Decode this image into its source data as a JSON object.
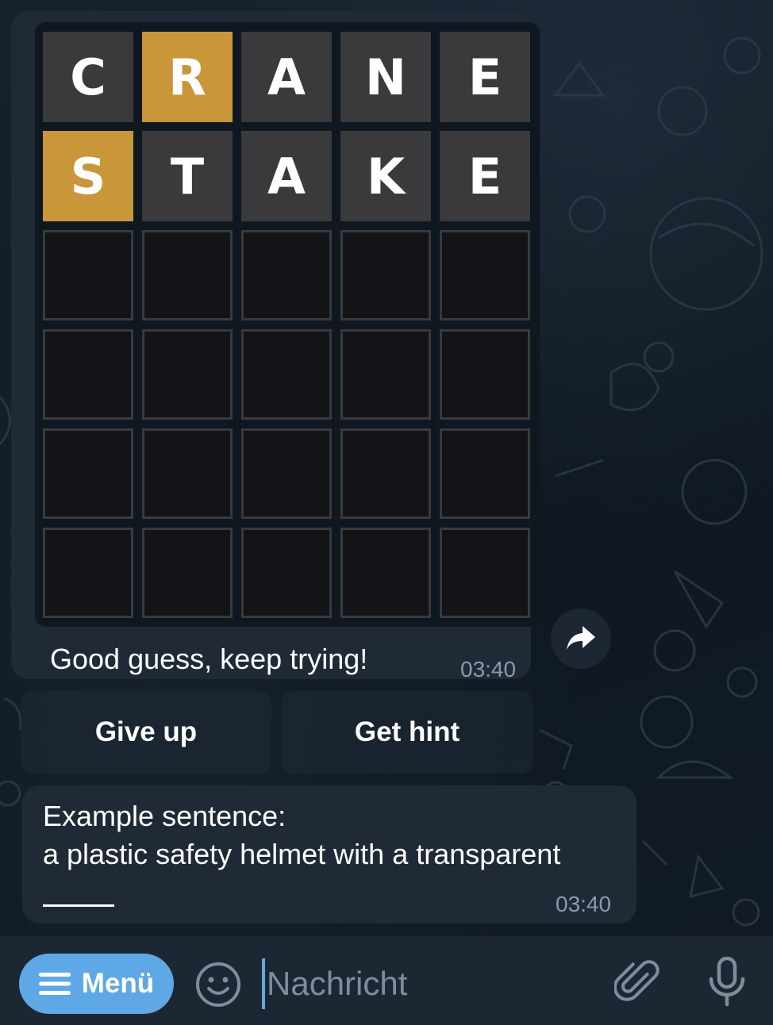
{
  "board": {
    "rows": [
      [
        {
          "letter": "C",
          "state": "absent"
        },
        {
          "letter": "R",
          "state": "present"
        },
        {
          "letter": "A",
          "state": "absent"
        },
        {
          "letter": "N",
          "state": "absent"
        },
        {
          "letter": "E",
          "state": "absent"
        }
      ],
      [
        {
          "letter": "S",
          "state": "present"
        },
        {
          "letter": "T",
          "state": "absent"
        },
        {
          "letter": "A",
          "state": "absent"
        },
        {
          "letter": "K",
          "state": "absent"
        },
        {
          "letter": "E",
          "state": "absent"
        }
      ],
      [
        {
          "letter": "",
          "state": "empty"
        },
        {
          "letter": "",
          "state": "empty"
        },
        {
          "letter": "",
          "state": "empty"
        },
        {
          "letter": "",
          "state": "empty"
        },
        {
          "letter": "",
          "state": "empty"
        }
      ],
      [
        {
          "letter": "",
          "state": "empty"
        },
        {
          "letter": "",
          "state": "empty"
        },
        {
          "letter": "",
          "state": "empty"
        },
        {
          "letter": "",
          "state": "empty"
        },
        {
          "letter": "",
          "state": "empty"
        }
      ],
      [
        {
          "letter": "",
          "state": "empty"
        },
        {
          "letter": "",
          "state": "empty"
        },
        {
          "letter": "",
          "state": "empty"
        },
        {
          "letter": "",
          "state": "empty"
        },
        {
          "letter": "",
          "state": "empty"
        }
      ],
      [
        {
          "letter": "",
          "state": "empty"
        },
        {
          "letter": "",
          "state": "empty"
        },
        {
          "letter": "",
          "state": "empty"
        },
        {
          "letter": "",
          "state": "empty"
        },
        {
          "letter": "",
          "state": "empty"
        }
      ]
    ],
    "colors": {
      "absent": "#3a3a3c",
      "present": "#c9963a",
      "empty_border": "#3a3a3c"
    }
  },
  "game_message": {
    "text": "Good guess, keep trying!",
    "time": "03:40",
    "share_icon": "share-arrow-icon"
  },
  "keyboard": {
    "give_up": "Give up",
    "get_hint": "Get hint"
  },
  "hint_message": {
    "line1": "Example sentence:",
    "line2": "a plastic safety helmet with a transparent",
    "time": "03:40"
  },
  "input_bar": {
    "menu_label": "Menü",
    "menu_icon": "hamburger-icon",
    "emoji_icon": "emoji-icon",
    "placeholder": "Nachricht",
    "attach_icon": "paperclip-icon",
    "mic_icon": "microphone-icon",
    "accent_color": "#5fa8e6"
  }
}
